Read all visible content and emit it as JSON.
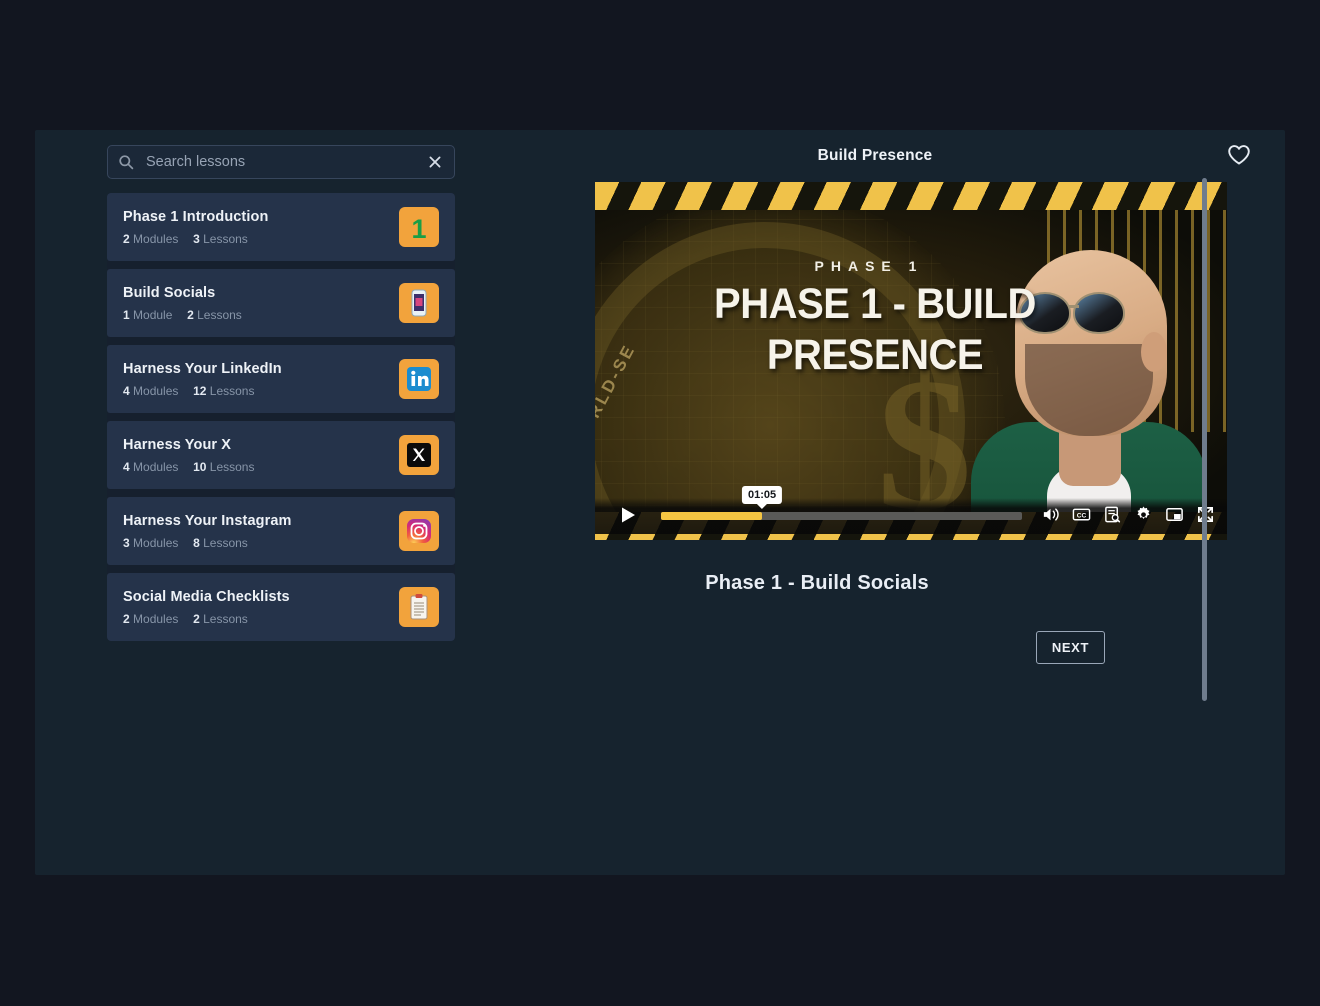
{
  "search": {
    "placeholder": "Search lessons",
    "value": "",
    "icon": "search-icon",
    "clear_icon": "close-icon"
  },
  "sidebar": {
    "items": [
      {
        "title": "Phase 1 Introduction",
        "modules": "2",
        "modules_label": "Modules",
        "lessons": "3",
        "lessons_label": "Lessons",
        "icon": "number-one-icon"
      },
      {
        "title": "Build Socials",
        "modules": "1",
        "modules_label": "Module",
        "lessons": "2",
        "lessons_label": "Lessons",
        "icon": "mobile-phone-icon"
      },
      {
        "title": "Harness Your LinkedIn",
        "modules": "4",
        "modules_label": "Modules",
        "lessons": "12",
        "lessons_label": "Lessons",
        "icon": "linkedin-icon"
      },
      {
        "title": "Harness Your X",
        "modules": "4",
        "modules_label": "Modules",
        "lessons": "10",
        "lessons_label": "Lessons",
        "icon": "x-twitter-icon"
      },
      {
        "title": "Harness Your Instagram",
        "modules": "3",
        "modules_label": "Modules",
        "lessons": "8",
        "lessons_label": "Lessons",
        "icon": "instagram-icon"
      },
      {
        "title": "Social Media Checklists",
        "modules": "2",
        "modules_label": "Modules",
        "lessons": "2",
        "lessons_label": "Lessons",
        "icon": "clipboard-icon"
      }
    ]
  },
  "header": {
    "title": "Build Presence",
    "favorite_icon": "heart-icon"
  },
  "video": {
    "thumbnail": {
      "kicker": "PHASE 1",
      "headline_line1": "PHASE 1 - BUILD",
      "headline_line2": "PRESENCE",
      "seal_text": "WORLD-SE"
    },
    "controls": {
      "play_icon": "play-icon",
      "time_tooltip": "01:05",
      "progress_percent": 28,
      "buttons": [
        {
          "name": "volume-icon",
          "label": "Volume"
        },
        {
          "name": "captions-icon",
          "label": "CC"
        },
        {
          "name": "transcript-search-icon",
          "label": "Transcript"
        },
        {
          "name": "gear-icon",
          "label": "Settings"
        },
        {
          "name": "picture-in-picture-icon",
          "label": "Picture in picture"
        },
        {
          "name": "fullscreen-icon",
          "label": "Fullscreen"
        }
      ]
    }
  },
  "main": {
    "lesson_heading": "Phase 1 - Build Socials",
    "next_label": "NEXT"
  },
  "colors": {
    "page_background": "#121620",
    "panel_background": "#16232e",
    "list_item": "#25334a",
    "icon_tile": "#f2a33c",
    "accent_yellow": "#f5c542",
    "text_primary": "#eef2f7",
    "text_muted": "#8795a8"
  }
}
